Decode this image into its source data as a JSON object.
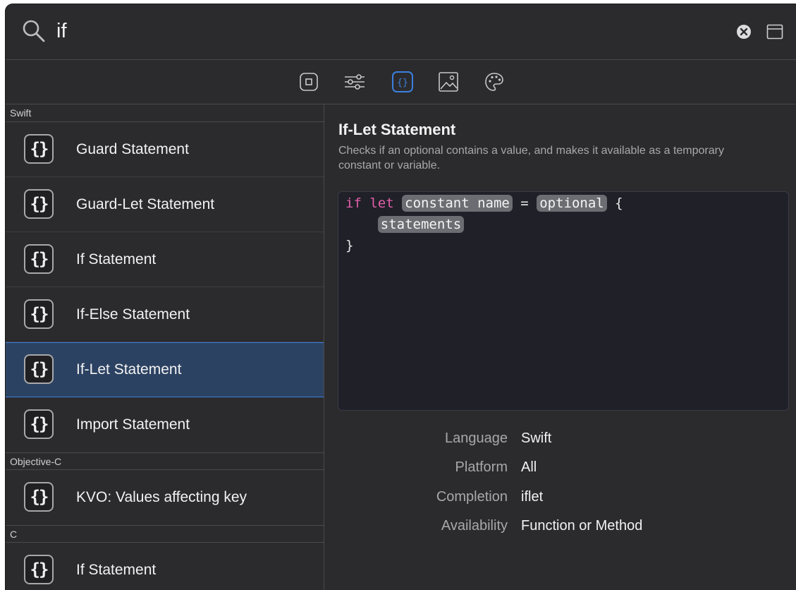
{
  "search": {
    "query": "if"
  },
  "sections": [
    {
      "header": "Swift",
      "items": [
        {
          "icon": "{}",
          "label": "Guard Statement"
        },
        {
          "icon": "{}",
          "label": "Guard-Let Statement"
        },
        {
          "icon": "{}",
          "label": "If Statement"
        },
        {
          "icon": "{}",
          "label": "If-Else Statement"
        },
        {
          "icon": "{}",
          "label": "If-Let Statement",
          "selected": true
        },
        {
          "icon": "{}",
          "label": "Import Statement"
        }
      ]
    },
    {
      "header": "Objective-C",
      "items": [
        {
          "icon": "{}",
          "label": "KVO: Values affecting key"
        }
      ]
    },
    {
      "header": "C",
      "items": [
        {
          "icon": "{}",
          "label": "If Statement"
        }
      ]
    }
  ],
  "detail": {
    "title": "If-Let Statement",
    "description": "Checks if an optional contains a value, and makes it available as a temporary constant or variable.",
    "code": {
      "kw_if": "if",
      "kw_let": "let",
      "ph_name": "constant name",
      "eq": "=",
      "ph_optional": "optional",
      "open_brace": "{",
      "ph_statements": "statements",
      "close_brace": "}"
    },
    "meta": [
      {
        "key": "Language",
        "value": "Swift"
      },
      {
        "key": "Platform",
        "value": "All"
      },
      {
        "key": "Completion",
        "value": "iflet"
      },
      {
        "key": "Availability",
        "value": "Function or Method"
      }
    ]
  },
  "colors": {
    "selection": "#2c4262",
    "accent": "#3c7fde",
    "keyword": "#e05ea9",
    "background": "#2b2b2d"
  }
}
